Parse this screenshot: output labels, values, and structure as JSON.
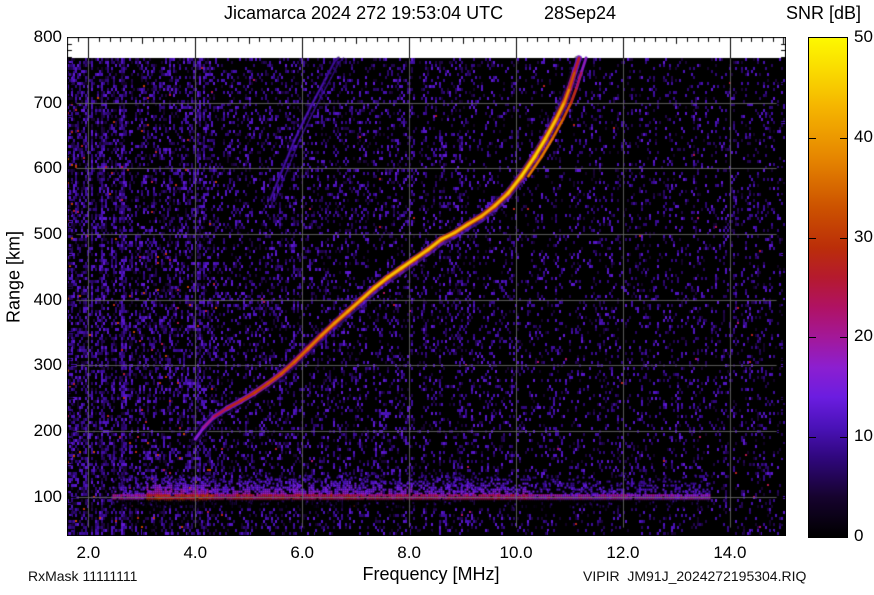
{
  "header": {
    "title": "Jicamarca 2024 272 19:53:04 UTC",
    "date_label": "28Sep24"
  },
  "footer": {
    "rx_mask": "RxMask 11111111",
    "source_file": "VIPIR  JM91J_2024272195304.RIQ"
  },
  "chart_data": {
    "type": "heatmap",
    "title": "Jicamarca 2024 272 19:53:04 UTC",
    "date_label": "28Sep24",
    "xlabel": "Frequency [MHz]",
    "ylabel": "Range [km]",
    "xlim": [
      1.6,
      15.05
    ],
    "ylim": [
      40,
      800
    ],
    "data_range_lim": [
      42,
      768
    ],
    "grid": true,
    "x_major_ticks": [
      2,
      4,
      6,
      8,
      10,
      12,
      14
    ],
    "x_tick_labels": [
      "2.0",
      "4.0",
      "6.0",
      "8.0",
      "10.0",
      "12.0",
      "14.0"
    ],
    "y_major_ticks": [
      100,
      200,
      300,
      400,
      500,
      600,
      700,
      800
    ],
    "y_tick_labels": [
      "100",
      "200",
      "300",
      "400",
      "500",
      "600",
      "700",
      "800"
    ],
    "colorbar": {
      "label": "SNR [dB]",
      "min": 0,
      "max": 50,
      "ticks": [
        0,
        10,
        20,
        30,
        40,
        50
      ],
      "tick_labels": [
        "0",
        "10",
        "20",
        "30",
        "40",
        "50"
      ],
      "palette_stops": [
        {
          "v": 0,
          "c": "#000000"
        },
        {
          "v": 4,
          "c": "#16032e"
        },
        {
          "v": 8,
          "c": "#30077e"
        },
        {
          "v": 11,
          "c": "#4a12b8"
        },
        {
          "v": 14,
          "c": "#6b1de0"
        },
        {
          "v": 17,
          "c": "#8c1fd0"
        },
        {
          "v": 20,
          "c": "#a31899"
        },
        {
          "v": 23,
          "c": "#b01264"
        },
        {
          "v": 26,
          "c": "#b51a2e"
        },
        {
          "v": 29,
          "c": "#bb2e09"
        },
        {
          "v": 33,
          "c": "#cc5200"
        },
        {
          "v": 38,
          "c": "#e68600"
        },
        {
          "v": 43,
          "c": "#f5b400"
        },
        {
          "v": 47,
          "c": "#fadd00"
        },
        {
          "v": 50,
          "c": "#fdf800"
        }
      ]
    },
    "series": [
      {
        "name": "F-region O-mode trace",
        "comment": "points are [frequency_MHz, virtual_range_km, SNR_dB]",
        "points": [
          [
            4.0,
            188,
            13
          ],
          [
            4.15,
            205,
            16
          ],
          [
            4.35,
            222,
            20
          ],
          [
            4.6,
            235,
            24
          ],
          [
            4.85,
            246,
            26
          ],
          [
            5.1,
            258,
            28
          ],
          [
            5.35,
            272,
            29
          ],
          [
            5.6,
            287,
            30
          ],
          [
            5.85,
            305,
            32
          ],
          [
            6.1,
            325,
            33
          ],
          [
            6.35,
            345,
            35
          ],
          [
            6.6,
            364,
            37
          ],
          [
            6.85,
            382,
            38
          ],
          [
            7.1,
            400,
            40
          ],
          [
            7.35,
            418,
            41
          ],
          [
            7.6,
            434,
            41
          ],
          [
            7.85,
            448,
            42
          ],
          [
            8.1,
            462,
            42
          ],
          [
            8.35,
            476,
            41
          ],
          [
            8.6,
            492,
            42
          ],
          [
            8.85,
            502,
            41
          ],
          [
            9.1,
            515,
            40
          ],
          [
            9.35,
            527,
            39
          ],
          [
            9.6,
            543,
            40
          ],
          [
            9.85,
            562,
            41
          ],
          [
            10.1,
            588,
            43
          ],
          [
            10.35,
            618,
            44
          ],
          [
            10.55,
            645,
            43
          ],
          [
            10.75,
            675,
            41
          ],
          [
            10.9,
            700,
            38
          ],
          [
            11.0,
            722,
            33
          ],
          [
            11.1,
            748,
            27
          ],
          [
            11.18,
            768,
            22
          ]
        ]
      },
      {
        "name": "F-region X-mode branch",
        "offset_mhz": 0.13,
        "min_range_km": 575,
        "snr_delta": -6
      },
      {
        "name": "second-hop faint trace",
        "points": [
          [
            5.4,
            552,
            10
          ],
          [
            5.55,
            582,
            11
          ],
          [
            5.7,
            612,
            11
          ],
          [
            5.85,
            642,
            12
          ],
          [
            6.05,
            676,
            12
          ],
          [
            6.25,
            708,
            12
          ],
          [
            6.45,
            738,
            11
          ],
          [
            6.6,
            762,
            10
          ],
          [
            6.68,
            768,
            9
          ]
        ]
      }
    ],
    "e_region_band": {
      "range_km": 101,
      "f_start_mhz": 2.45,
      "f_end_mhz": 13.6,
      "bright_segment_mhz": [
        3.1,
        4.3
      ],
      "glow_top_km": 140
    },
    "noise": {
      "seed": 1234567,
      "description": "vertical RFI striping, dense below 4.3 MHz, sparse purple speckle elsewhere"
    }
  }
}
